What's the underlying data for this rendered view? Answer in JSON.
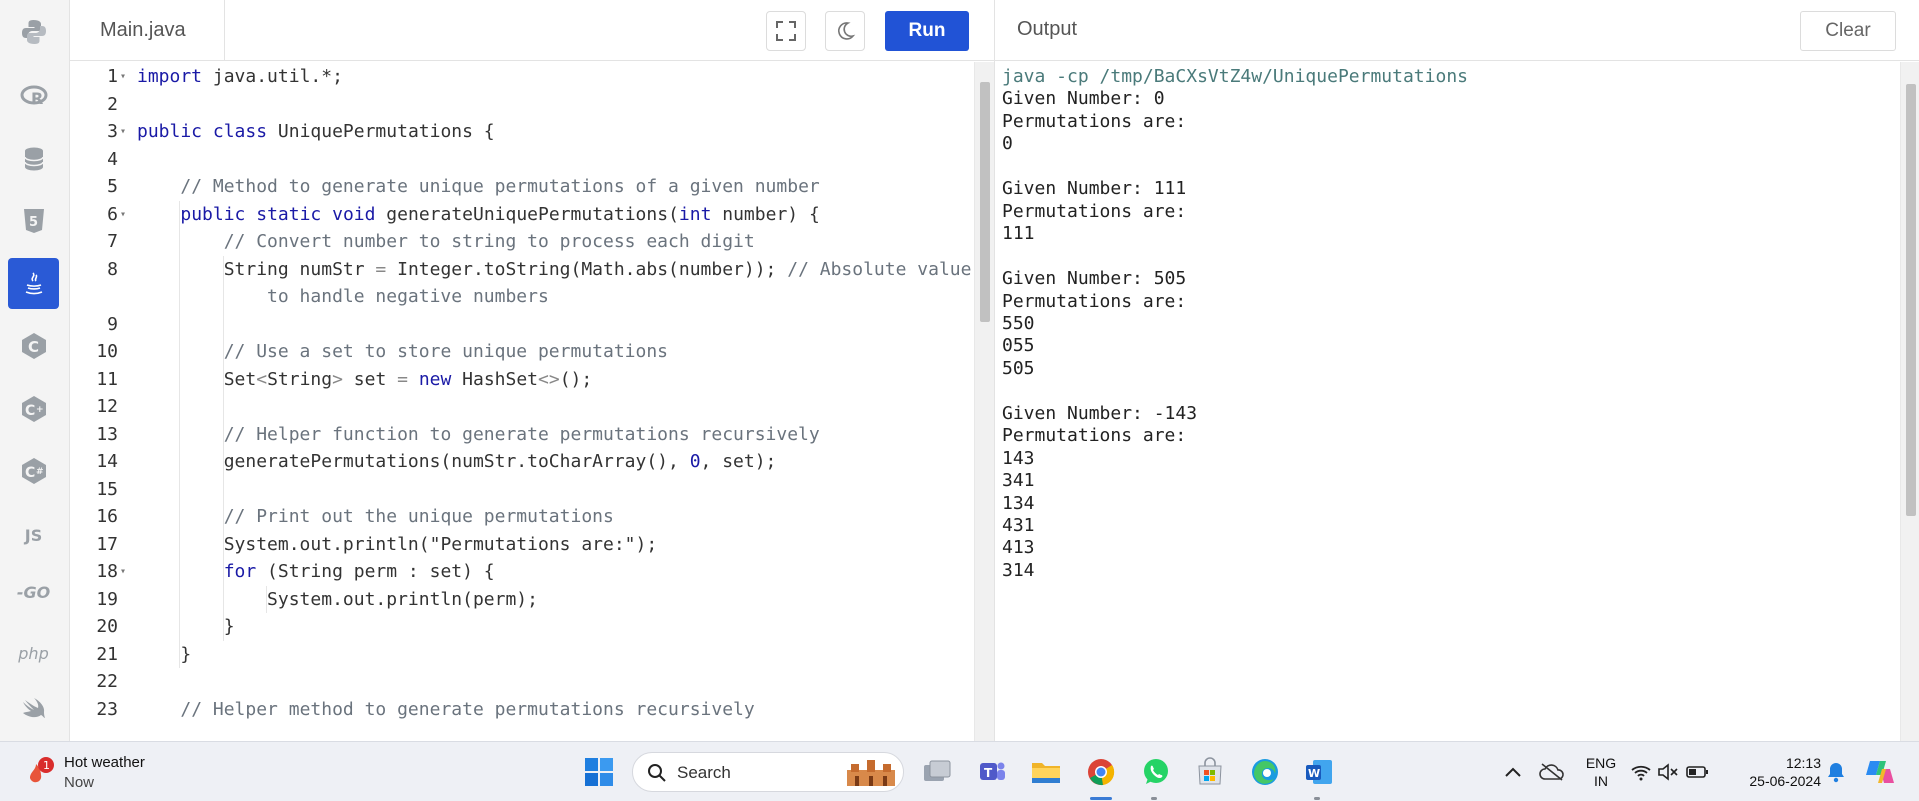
{
  "sidebar": {
    "items": [
      {
        "name": "python",
        "icon": "python-icon"
      },
      {
        "name": "r",
        "icon": "r-icon"
      },
      {
        "name": "sql",
        "icon": "database-icon"
      },
      {
        "name": "html",
        "icon": "html5-icon"
      },
      {
        "name": "java",
        "icon": "java-icon",
        "active": true
      },
      {
        "name": "c",
        "icon": "c-icon"
      },
      {
        "name": "cpp",
        "icon": "cpp-icon"
      },
      {
        "name": "csharp",
        "icon": "csharp-icon"
      },
      {
        "name": "js",
        "label": "JS"
      },
      {
        "name": "go",
        "label": "-GO"
      },
      {
        "name": "php",
        "label": "php"
      },
      {
        "name": "swift",
        "icon": "swift-icon"
      }
    ]
  },
  "editor": {
    "file_tab": "Main.java",
    "run_label": "Run",
    "lines": [
      {
        "n": "1",
        "fold": true,
        "t": "import java.util.*;"
      },
      {
        "n": "2",
        "t": ""
      },
      {
        "n": "3",
        "fold": true,
        "t": "public class UniquePermutations {"
      },
      {
        "n": "4",
        "t": ""
      },
      {
        "n": "5",
        "t": "    // Method to generate unique permutations of a given number"
      },
      {
        "n": "6",
        "fold": true,
        "t": "    public static void generateUniquePermutations(int number) {"
      },
      {
        "n": "7",
        "t": "        // Convert number to string to process each digit"
      },
      {
        "n": "8",
        "t": "        String numStr = Integer.toString(Math.abs(number)); // Absolute value"
      },
      {
        "n": "",
        "t": "            to handle negative numbers"
      },
      {
        "n": "9",
        "t": ""
      },
      {
        "n": "10",
        "t": "        // Use a set to store unique permutations"
      },
      {
        "n": "11",
        "t": "        Set<String> set = new HashSet<>();"
      },
      {
        "n": "12",
        "t": ""
      },
      {
        "n": "13",
        "t": "        // Helper function to generate permutations recursively"
      },
      {
        "n": "14",
        "t": "        generatePermutations(numStr.toCharArray(), 0, set);"
      },
      {
        "n": "15",
        "t": ""
      },
      {
        "n": "16",
        "t": "        // Print out the unique permutations"
      },
      {
        "n": "17",
        "t": "        System.out.println(\"Permutations are:\");"
      },
      {
        "n": "18",
        "fold": true,
        "t": "        for (String perm : set) {"
      },
      {
        "n": "19",
        "t": "            System.out.println(perm);"
      },
      {
        "n": "20",
        "t": "        }"
      },
      {
        "n": "21",
        "t": "    }"
      },
      {
        "n": "22",
        "t": ""
      },
      {
        "n": "23",
        "t": "    // Helper method to generate permutations recursively"
      }
    ]
  },
  "output": {
    "title": "Output",
    "clear_label": "Clear",
    "lines": [
      "java -cp /tmp/BaCXsVtZ4w/UniquePermutations",
      "Given Number: 0",
      "Permutations are:",
      "0",
      "",
      "Given Number: 111",
      "Permutations are:",
      "111",
      "",
      "Given Number: 505",
      "Permutations are:",
      "550",
      "055",
      "505",
      "",
      "Given Number: -143",
      "Permutations are:",
      "143",
      "341",
      "134",
      "431",
      "413",
      "314"
    ]
  },
  "taskbar": {
    "weather_title": "Hot weather",
    "weather_sub": "Now",
    "weather_badge": "1",
    "search_label": "Search",
    "lang_line1": "ENG",
    "lang_line2": "IN",
    "time": "12:13",
    "date": "25-06-2024"
  },
  "colors": {
    "accent": "#2153d6",
    "active_language": "#2a5ad6"
  }
}
